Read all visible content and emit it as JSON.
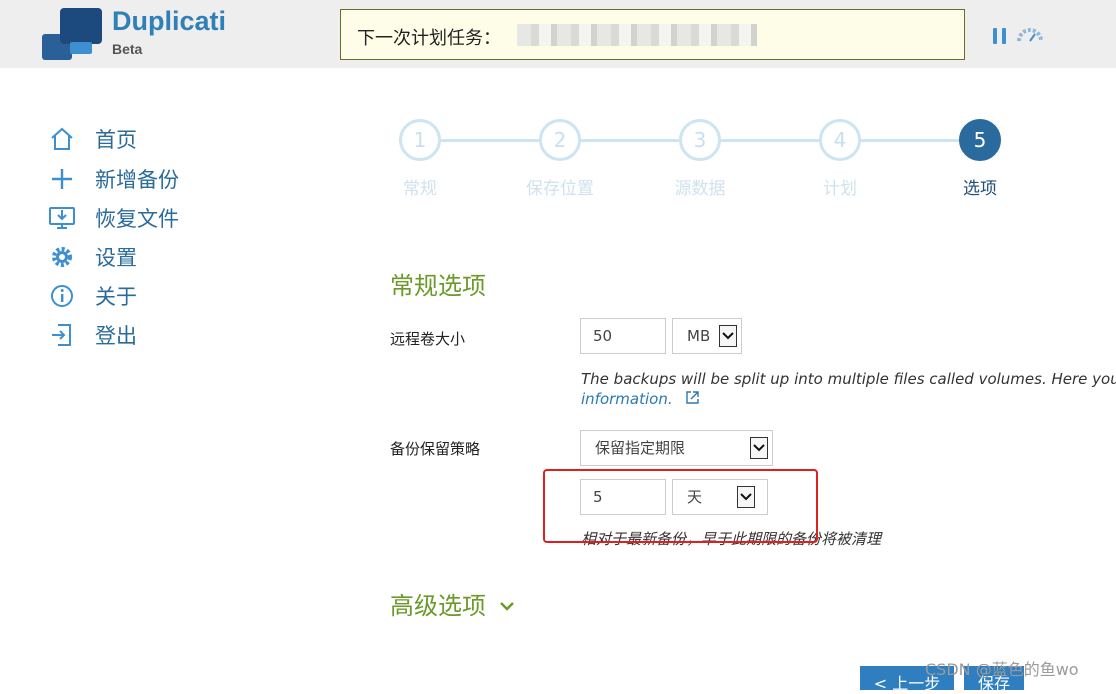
{
  "header": {
    "brand": "Duplicati",
    "brand_sub": "Beta",
    "next_task_label": "下一次计划任务："
  },
  "nav": {
    "items": [
      {
        "label": "首页",
        "icon": "home-icon"
      },
      {
        "label": "新增备份",
        "icon": "plus-icon"
      },
      {
        "label": "恢复文件",
        "icon": "restore-icon"
      },
      {
        "label": "设置",
        "icon": "gear-icon"
      },
      {
        "label": "关于",
        "icon": "info-icon"
      },
      {
        "label": "登出",
        "icon": "logout-icon"
      }
    ]
  },
  "stepper": {
    "steps": [
      {
        "num": "1",
        "label": "常规"
      },
      {
        "num": "2",
        "label": "保存位置"
      },
      {
        "num": "3",
        "label": "源数据"
      },
      {
        "num": "4",
        "label": "计划"
      },
      {
        "num": "5",
        "label": "选项"
      }
    ],
    "active_step": 5
  },
  "form": {
    "general_title": "常规选项",
    "volume_size_label": "远程卷大小",
    "volume_size_value": "50",
    "volume_unit": "MB",
    "volume_help": "The backups will be split up into multiple files called volumes. Here you can",
    "volume_help_link": "information.",
    "retention_label": "备份保留策略",
    "retention_policy": "保留指定期限",
    "retention_value": "5",
    "retention_unit": "天",
    "retention_help": "相对于最新备份，早于此期限的备份将被清理",
    "advanced_title": "高级选项"
  },
  "buttons": {
    "prev": "< 上一步",
    "save": "保存"
  },
  "watermark": "CSDN @蓝色的鱼wo",
  "colors": {
    "accent": "#2a6a9c",
    "section_green": "#6c9a2a",
    "highlight": "#e02020"
  }
}
